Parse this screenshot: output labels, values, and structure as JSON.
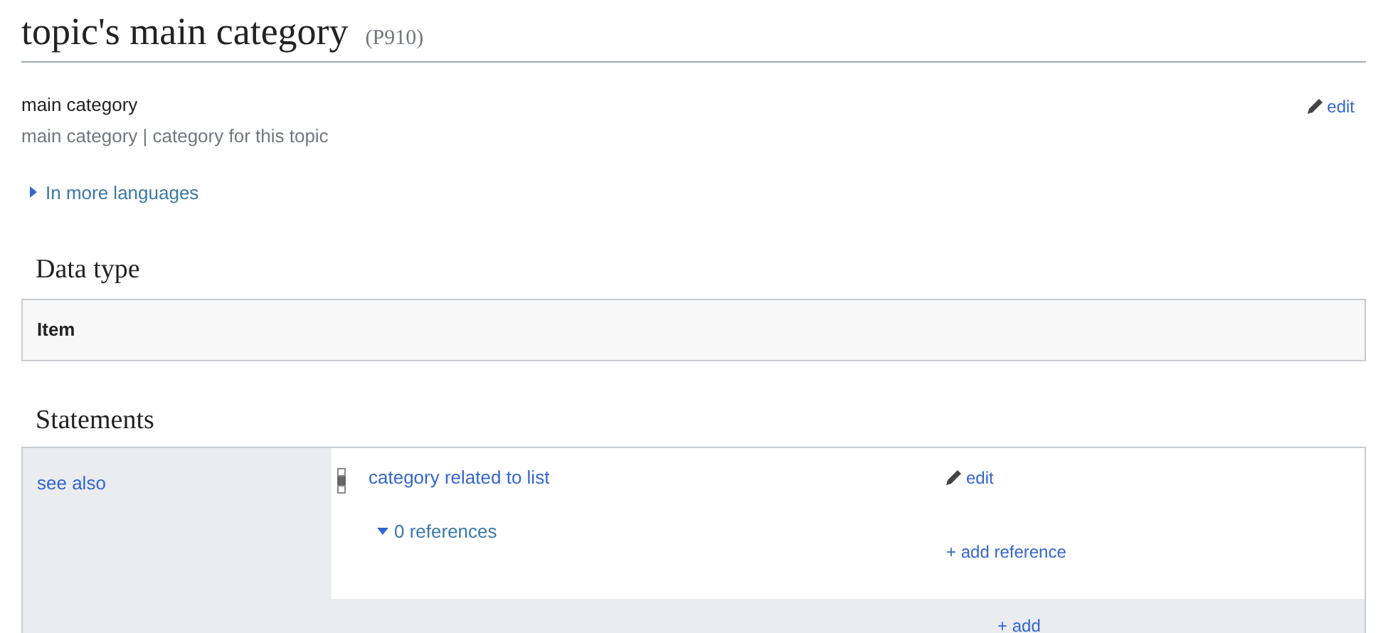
{
  "heading": {
    "title": "topic's main category",
    "id": "(P910)"
  },
  "label": "main category",
  "edit": "edit",
  "aliases": "main category | category for this topic",
  "languages": {
    "label": "In more languages",
    "expanded": false
  },
  "data_type": {
    "heading": "Data type",
    "value": "Item"
  },
  "statements": {
    "heading": "Statements",
    "groups": [
      {
        "property": "see also",
        "values": [
          {
            "value": "category related to list",
            "edit": "edit",
            "references": {
              "label": "0 references",
              "expanded": true
            },
            "add_reference": "+ add reference"
          }
        ],
        "add": "+ add"
      }
    ]
  }
}
